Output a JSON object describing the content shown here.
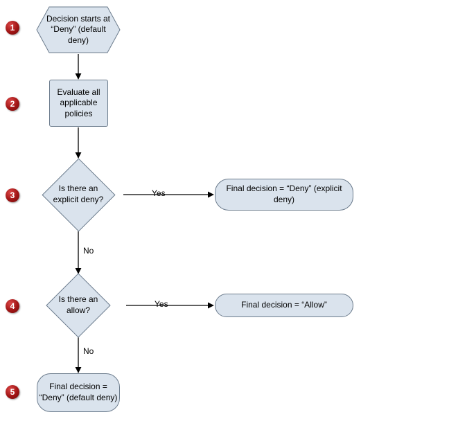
{
  "steps": {
    "s1": "1",
    "s2": "2",
    "s3": "3",
    "s4": "4",
    "s5": "5"
  },
  "nodes": {
    "start": "Decision starts at “Deny” (default deny)",
    "evaluate": "Evaluate all applicable policies",
    "explicit_deny_q": "Is there an explicit deny?",
    "allow_q": "Is there an allow?",
    "final_deny_explicit": "Final decision = “Deny” (explicit deny)",
    "final_allow": "Final decision = “Allow”",
    "final_deny_default": "Final decision = “Deny” (default deny)"
  },
  "edges": {
    "yes": "Yes",
    "no": "No"
  },
  "colors": {
    "fill": "#dae3ed",
    "border": "#6b7b8c",
    "badge": "#a01414"
  }
}
